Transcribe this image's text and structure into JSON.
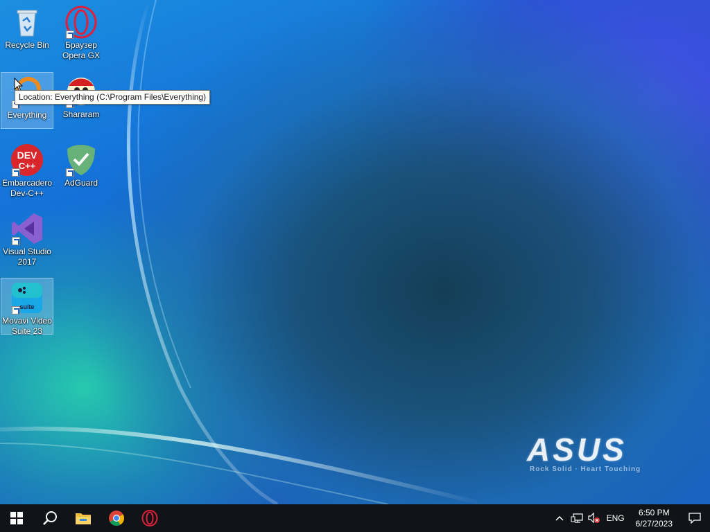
{
  "desktop": {
    "icons": [
      {
        "label": "Recycle Bin"
      },
      {
        "label": "Браузер Opera GX"
      },
      {
        "label": "Everything"
      },
      {
        "label": "Shararam"
      },
      {
        "label": "Embarcadero Dev-C++"
      },
      {
        "label": "AdGuard"
      },
      {
        "label": "Visual Studio 2017"
      },
      {
        "label": "Movavi Video Suite 23"
      }
    ],
    "devcpp_icon_text": "DEV C++",
    "movavi_icon_text": "suite",
    "tooltip": "Location: Everything (C:\\Program Files\\Everything)"
  },
  "wallpaper": {
    "brand": "ASUS",
    "tagline": "Rock Solid · Heart Touching"
  },
  "taskbar": {
    "pinned": [
      "start-icon",
      "search-icon",
      "file-explorer-icon",
      "chrome-icon",
      "opera-icon"
    ],
    "tray": {
      "language": "ENG",
      "time": "6:50 PM",
      "date": "6/27/2023"
    }
  },
  "colors": {
    "taskbar_bg": "#101418",
    "windows_blue": "#ffffff",
    "opera_red": "#e0203a",
    "adguard_green": "#67b279",
    "vs_purple": "#8a5fcf"
  }
}
